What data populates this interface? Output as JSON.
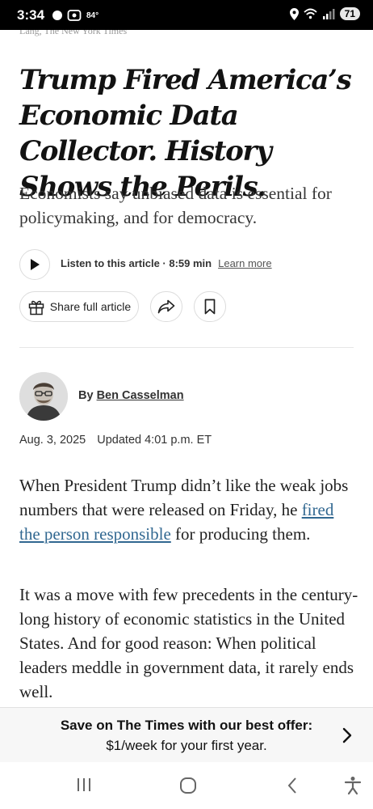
{
  "status_bar": {
    "time": "3:34",
    "temperature": "84°",
    "battery": "71"
  },
  "article": {
    "clipped_source_line": "Lang, The New York Times",
    "headline": "Trump Fired America’s Economic Data Collector. History Shows the Perils.",
    "dek": "Economists say unbiased data is essential for policymaking, and for democracy.",
    "listen": {
      "label": "Listen to this article · 8:59 min",
      "learn_more": "Learn more"
    },
    "share_full_article": "Share full article",
    "byline": {
      "prefix": "By",
      "author": "Ben Casselman"
    },
    "date": "Aug. 3, 2025",
    "updated": "Updated 4:01 p.m. ET",
    "paragraph1": {
      "before": "When President Trump didn’t like the weak jobs numbers that were released on Friday, he ",
      "link": "fired the person responsible",
      "after": " for producing them."
    },
    "paragraph2": "It was a move with few precedents in the century-long history of economic statistics in the United States. And for good reason: When political leaders meddle in government data, it rarely ends well."
  },
  "offer": {
    "line1": "Save on The Times with our best offer:",
    "line2": "$1/week for your first year."
  },
  "icons": {
    "play": "play-icon",
    "gift": "gift-icon",
    "share": "share-arrow-icon",
    "bookmark": "bookmark-icon",
    "offer_chevron": "chevron-right-icon",
    "nav_recents": "recents-icon",
    "nav_home": "home-icon",
    "nav_back": "back-icon",
    "nav_accessibility": "accessibility-icon"
  },
  "colors": {
    "link": "#326891",
    "text": "#121212",
    "offer_background": "#f7f7f7"
  }
}
